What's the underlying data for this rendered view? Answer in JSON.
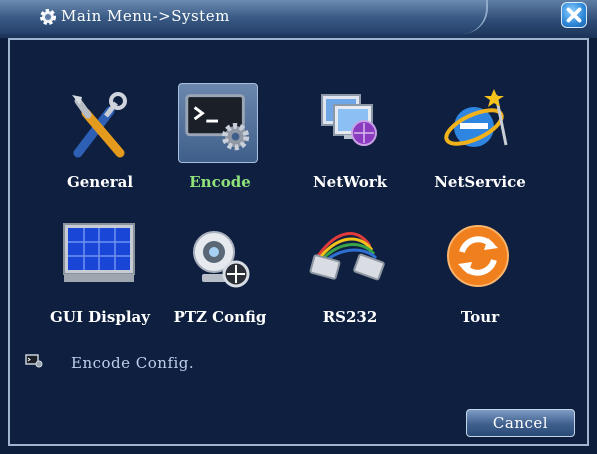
{
  "window": {
    "title": "Main Menu->System"
  },
  "tiles": [
    {
      "label": "General",
      "icon": "tools-icon",
      "selected": false
    },
    {
      "label": "Encode",
      "icon": "terminal-gear-icon",
      "selected": true
    },
    {
      "label": "NetWork",
      "icon": "network-computers-icon",
      "selected": false
    },
    {
      "label": "NetService",
      "icon": "internet-globe-icon",
      "selected": false
    },
    {
      "label": "GUI Display",
      "icon": "display-grid-icon",
      "selected": false
    },
    {
      "label": "PTZ Config",
      "icon": "ptz-camera-icon",
      "selected": false
    },
    {
      "label": "RS232",
      "icon": "serial-cable-icon",
      "selected": false
    },
    {
      "label": "Tour",
      "icon": "refresh-cycle-icon",
      "selected": false
    }
  ],
  "status": {
    "text": "Encode Config.",
    "icon": "encode-small-icon"
  },
  "buttons": {
    "cancel_label": "Cancel"
  },
  "colors": {
    "selected_label": "#8fe37a",
    "background": "#0e1f3f",
    "title_bar": "#3b5c86"
  }
}
